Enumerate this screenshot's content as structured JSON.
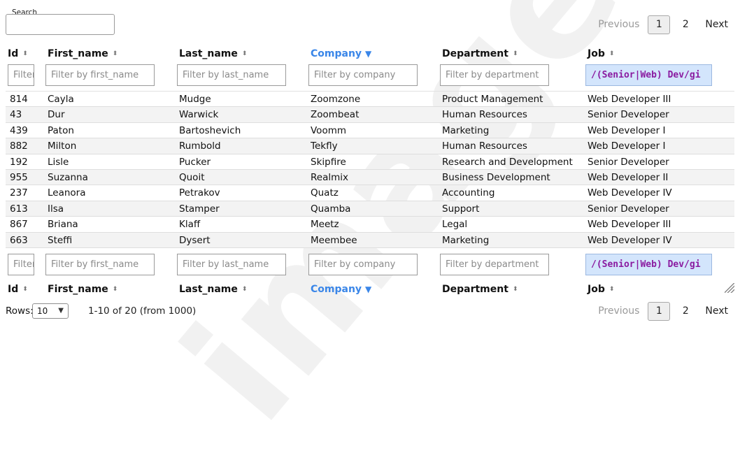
{
  "search": {
    "legend": "Search",
    "value": ""
  },
  "pager": {
    "previous": "Previous",
    "next": "Next",
    "pages": [
      "1",
      "2"
    ],
    "current": "1"
  },
  "columns": [
    {
      "key": "id",
      "label": "Id",
      "sort_icon": "sort-icon",
      "active": false,
      "filter_placeholder": "Filter by id",
      "filter_value": ""
    },
    {
      "key": "first_name",
      "label": "First_name",
      "sort_icon": "sort-icon",
      "active": false,
      "filter_placeholder": "Filter by first_name",
      "filter_value": ""
    },
    {
      "key": "last_name",
      "label": "Last_name",
      "sort_icon": "sort-icon",
      "active": false,
      "filter_placeholder": "Filter by last_name",
      "filter_value": ""
    },
    {
      "key": "company",
      "label": "Company",
      "sort_icon": "sort-desc-icon",
      "active": true,
      "filter_placeholder": "Filter by company",
      "filter_value": ""
    },
    {
      "key": "department",
      "label": "Department",
      "sort_icon": "sort-icon",
      "active": false,
      "filter_placeholder": "Filter by department",
      "filter_value": ""
    },
    {
      "key": "job",
      "label": "Job",
      "sort_icon": "sort-icon",
      "active": false,
      "filter_placeholder": "",
      "filter_value": "/(Senior|Web) Dev/gi"
    }
  ],
  "rows": [
    [
      "814",
      "Cayla",
      "Mudge",
      "Zoomzone",
      "Product Management",
      "Web Developer III"
    ],
    [
      "43",
      "Dur",
      "Warwick",
      "Zoombeat",
      "Human Resources",
      "Senior Developer"
    ],
    [
      "439",
      "Paton",
      "Bartoshevich",
      "Voomm",
      "Marketing",
      "Web Developer I"
    ],
    [
      "882",
      "Milton",
      "Rumbold",
      "Tekfly",
      "Human Resources",
      "Web Developer I"
    ],
    [
      "192",
      "Lisle",
      "Pucker",
      "Skipfire",
      "Research and Development",
      "Senior Developer"
    ],
    [
      "955",
      "Suzanna",
      "Quoit",
      "Realmix",
      "Business Development",
      "Web Developer II"
    ],
    [
      "237",
      "Leanora",
      "Petrakov",
      "Quatz",
      "Accounting",
      "Web Developer IV"
    ],
    [
      "613",
      "Ilsa",
      "Stamper",
      "Quamba",
      "Support",
      "Senior Developer"
    ],
    [
      "867",
      "Briana",
      "Klaff",
      "Meetz",
      "Legal",
      "Web Developer III"
    ],
    [
      "663",
      "Steffi",
      "Dysert",
      "Meembee",
      "Marketing",
      "Web Developer IV"
    ]
  ],
  "footer": {
    "rows_label": "Rows:",
    "rows_value": "10",
    "summary": "1-10 of 20 (from 1000)"
  },
  "colors": {
    "accent": "#3a86e8",
    "regex_text": "#8a1aa0",
    "regex_bg": "#d3e5fc"
  },
  "watermark": "image"
}
